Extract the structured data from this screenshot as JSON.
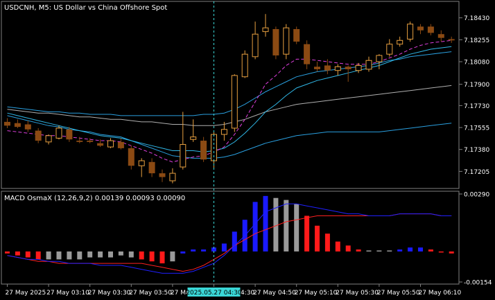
{
  "colors": {
    "background": "#000000",
    "panel_border": "#7f7f7f",
    "text": "#ffffff",
    "bull_candle": "#e8a040",
    "bear_candle": "#8b4a13",
    "ma_magenta": "#e040e0",
    "ma_cyan_fast": "#30b8e8",
    "ma_gray": "#b0b0b0",
    "band": "#2aa0e0",
    "crosshair": "#3ad7d7",
    "crosshair_label_bg": "#3ad7d7",
    "macd_up": "#1a1aff",
    "macd_down": "#ff1a1a",
    "macd_flat": "#9a9a9a",
    "macd_signal": "#ff2020",
    "macd_main": "#2020ff"
  },
  "chart_data": [
    {
      "type": "candlestick",
      "title": "USDCNH, M5:  US Dollar vs China Offshore Spot",
      "ylim": [
        7.1708,
        7.1855
      ],
      "yticks": [
        7.1843,
        7.18255,
        7.1808,
        7.179,
        7.1773,
        7.17555,
        7.1738,
        7.17205
      ],
      "ytick_labels": [
        "7.18430",
        "7.18255",
        "7.18080",
        "7.17900",
        "7.17730",
        "7.17555",
        "7.17380",
        "7.17205"
      ],
      "bars": [
        {
          "o": 7.176,
          "h": 7.1763,
          "l": 7.1755,
          "c": 7.1757
        },
        {
          "o": 7.1759,
          "h": 7.1762,
          "l": 7.1755,
          "c": 7.1756
        },
        {
          "o": 7.1758,
          "h": 7.1761,
          "l": 7.1752,
          "c": 7.1754
        },
        {
          "o": 7.1753,
          "h": 7.1755,
          "l": 7.1743,
          "c": 7.1745
        },
        {
          "o": 7.1744,
          "h": 7.175,
          "l": 7.1742,
          "c": 7.1749
        },
        {
          "o": 7.1747,
          "h": 7.1757,
          "l": 7.1746,
          "c": 7.1755
        },
        {
          "o": 7.1754,
          "h": 7.1756,
          "l": 7.1744,
          "c": 7.1746
        },
        {
          "o": 7.1745,
          "h": 7.1748,
          "l": 7.1743,
          "c": 7.1744
        },
        {
          "o": 7.1745,
          "h": 7.1747,
          "l": 7.1743,
          "c": 7.1744
        },
        {
          "o": 7.1743,
          "h": 7.1746,
          "l": 7.174,
          "c": 7.1741
        },
        {
          "o": 7.174,
          "h": 7.1747,
          "l": 7.1739,
          "c": 7.1745
        },
        {
          "o": 7.1744,
          "h": 7.1747,
          "l": 7.1738,
          "c": 7.1739
        },
        {
          "o": 7.1739,
          "h": 7.1741,
          "l": 7.1722,
          "c": 7.1725
        },
        {
          "o": 7.1725,
          "h": 7.1731,
          "l": 7.1716,
          "c": 7.1729
        },
        {
          "o": 7.1728,
          "h": 7.1731,
          "l": 7.1716,
          "c": 7.1719
        },
        {
          "o": 7.1719,
          "h": 7.1722,
          "l": 7.1712,
          "c": 7.1716
        },
        {
          "o": 7.1713,
          "h": 7.1723,
          "l": 7.1711,
          "c": 7.1719
        },
        {
          "o": 7.1724,
          "h": 7.1768,
          "l": 7.1722,
          "c": 7.1742
        },
        {
          "o": 7.1746,
          "h": 7.1762,
          "l": 7.1744,
          "c": 7.1748
        },
        {
          "o": 7.1745,
          "h": 7.1748,
          "l": 7.1728,
          "c": 7.173
        },
        {
          "o": 7.1729,
          "h": 7.1752,
          "l": 7.1723,
          "c": 7.175
        },
        {
          "o": 7.175,
          "h": 7.176,
          "l": 7.1745,
          "c": 7.1754
        },
        {
          "o": 7.1755,
          "h": 7.1798,
          "l": 7.1752,
          "c": 7.1797
        },
        {
          "o": 7.1796,
          "h": 7.1817,
          "l": 7.1795,
          "c": 7.1814
        },
        {
          "o": 7.1812,
          "h": 7.184,
          "l": 7.181,
          "c": 7.183
        },
        {
          "o": 7.1832,
          "h": 7.1846,
          "l": 7.1828,
          "c": 7.1835
        },
        {
          "o": 7.1834,
          "h": 7.1836,
          "l": 7.181,
          "c": 7.1813
        },
        {
          "o": 7.1814,
          "h": 7.1838,
          "l": 7.181,
          "c": 7.1835
        },
        {
          "o": 7.1834,
          "h": 7.1836,
          "l": 7.1822,
          "c": 7.1824
        },
        {
          "o": 7.1822,
          "h": 7.1825,
          "l": 7.1802,
          "c": 7.1806
        },
        {
          "o": 7.1804,
          "h": 7.1808,
          "l": 7.18,
          "c": 7.1802
        },
        {
          "o": 7.1805,
          "h": 7.181,
          "l": 7.1798,
          "c": 7.1801
        },
        {
          "o": 7.1801,
          "h": 7.1806,
          "l": 7.1797,
          "c": 7.1804
        },
        {
          "o": 7.1804,
          "h": 7.1805,
          "l": 7.1792,
          "c": 7.1802
        },
        {
          "o": 7.1801,
          "h": 7.1807,
          "l": 7.1799,
          "c": 7.1805
        },
        {
          "o": 7.1802,
          "h": 7.1812,
          "l": 7.18,
          "c": 7.1809
        },
        {
          "o": 7.1808,
          "h": 7.1814,
          "l": 7.1802,
          "c": 7.1813
        },
        {
          "o": 7.1814,
          "h": 7.1826,
          "l": 7.1812,
          "c": 7.1822
        },
        {
          "o": 7.1822,
          "h": 7.1828,
          "l": 7.182,
          "c": 7.1825
        },
        {
          "o": 7.1826,
          "h": 7.184,
          "l": 7.1824,
          "c": 7.1838
        },
        {
          "o": 7.1836,
          "h": 7.1838,
          "l": 7.183,
          "c": 7.1833
        },
        {
          "o": 7.1836,
          "h": 7.1838,
          "l": 7.1829,
          "c": 7.1831
        },
        {
          "o": 7.183,
          "h": 7.1833,
          "l": 7.1824,
          "c": 7.1827
        },
        {
          "o": 7.1826,
          "h": 7.1828,
          "l": 7.1823,
          "c": 7.1825
        }
      ],
      "ma_magenta": [
        7.1753,
        7.1752,
        7.1751,
        7.175,
        7.1749,
        7.1749,
        7.1748,
        7.1747,
        7.1746,
        7.1745,
        7.1745,
        7.1744,
        7.1741,
        7.1738,
        7.1735,
        7.1731,
        7.1728,
        7.173,
        7.1732,
        7.1733,
        7.1736,
        7.174,
        7.175,
        7.1762,
        7.1776,
        7.179,
        7.1797,
        7.1805,
        7.181,
        7.181,
        7.1809,
        7.1808,
        7.1807,
        7.1806,
        7.1806,
        7.1806,
        7.1808,
        7.1811,
        7.1814,
        7.1818,
        7.1821,
        7.1823,
        7.1824,
        7.1825
      ],
      "ma_cyan_fast": [
        7.1767,
        7.1765,
        7.1763,
        7.1761,
        7.1759,
        7.1757,
        7.1755,
        7.1753,
        7.1751,
        7.1749,
        7.1748,
        7.1747,
        7.1745,
        7.1743,
        7.1741,
        7.1739,
        7.1737,
        7.1737,
        7.1737,
        7.1736,
        7.1737,
        7.1739,
        7.1744,
        7.1751,
        7.1759,
        7.1768,
        7.1774,
        7.1781,
        7.1787,
        7.179,
        7.1793,
        7.1795,
        7.1797,
        7.1799,
        7.1801,
        7.1803,
        7.1805,
        7.1808,
        7.1811,
        7.1814,
        7.1816,
        7.1818,
        7.1819,
        7.182
      ],
      "ma_gray": [
        7.177,
        7.1769,
        7.1768,
        7.1767,
        7.1767,
        7.1766,
        7.1765,
        7.1764,
        7.1764,
        7.1763,
        7.1762,
        7.1762,
        7.1761,
        7.176,
        7.176,
        7.1759,
        7.1758,
        7.1758,
        7.1757,
        7.1757,
        7.1757,
        7.1758,
        7.176,
        7.1762,
        7.1765,
        7.1768,
        7.177,
        7.1772,
        7.1774,
        7.1775,
        7.1776,
        7.1777,
        7.1778,
        7.1779,
        7.178,
        7.1781,
        7.1782,
        7.1783,
        7.1784,
        7.1785,
        7.1786,
        7.1787,
        7.1788,
        7.1789
      ],
      "band_upper": [
        7.1772,
        7.1771,
        7.177,
        7.1769,
        7.1768,
        7.1768,
        7.1767,
        7.1767,
        7.1766,
        7.1766,
        7.1766,
        7.1765,
        7.1765,
        7.1765,
        7.1765,
        7.1765,
        7.1765,
        7.1765,
        7.1765,
        7.1766,
        7.1766,
        7.1767,
        7.177,
        7.1774,
        7.1779,
        7.1784,
        7.1788,
        7.1792,
        7.1796,
        7.1798,
        7.18,
        7.1801,
        7.1802,
        7.1803,
        7.1804,
        7.1805,
        7.1807,
        7.1809,
        7.181,
        7.1812,
        7.1813,
        7.1814,
        7.1815,
        7.1816
      ],
      "band_lower": [
        7.1765,
        7.1763,
        7.1761,
        7.1759,
        7.1757,
        7.1756,
        7.1754,
        7.1753,
        7.1752,
        7.175,
        7.1749,
        7.1748,
        7.1745,
        7.1742,
        7.1739,
        7.1736,
        7.1733,
        7.1732,
        7.1731,
        7.1731,
        7.1731,
        7.1732,
        7.1734,
        7.1737,
        7.174,
        7.1743,
        7.1745,
        7.1747,
        7.1749,
        7.175,
        7.1751,
        7.1752,
        7.1752,
        7.1752,
        7.1752,
        7.1752,
        7.1752,
        7.1753,
        7.1754,
        7.1755,
        7.1756,
        7.1757,
        7.1758,
        7.1759
      ]
    },
    {
      "type": "bar",
      "title": "MACD OsmaX (12,26,9,2) 0.00139 0.00093 0.00090",
      "ylim": [
        -0.00154,
        0.0029
      ],
      "ytick_labels": [
        "0.00290",
        "-0.00154"
      ],
      "histogram": [
        -0.0001,
        -0.0002,
        -0.0003,
        -0.0004,
        -0.0004,
        -0.0004,
        -0.0004,
        -0.0004,
        -0.0003,
        -0.0003,
        -0.0003,
        -0.0002,
        -0.0003,
        -0.0004,
        -0.0005,
        -0.0006,
        -0.0005,
        -0.0001,
        0.0001,
        0.0001,
        0.0002,
        0.0004,
        0.001,
        0.0016,
        0.0025,
        0.0028,
        0.0027,
        0.0026,
        0.0024,
        0.0018,
        0.0013,
        0.0009,
        0.0005,
        0.0003,
        0.0001,
        5e-05,
        5e-05,
        5e-05,
        0.0001,
        0.0002,
        0.0002,
        0.0001,
        0.0,
        -0.0001
      ],
      "histogram_state": [
        "down",
        "down",
        "down",
        "down",
        "flat",
        "flat",
        "flat",
        "flat",
        "flat",
        "flat",
        "flat",
        "flat",
        "flat",
        "down",
        "down",
        "down",
        "flat",
        "up",
        "up",
        "up",
        "up",
        "up",
        "up",
        "up",
        "up",
        "up",
        "flat",
        "flat",
        "flat",
        "down",
        "down",
        "down",
        "down",
        "down",
        "down",
        "flat",
        "flat",
        "flat",
        "up",
        "up",
        "up",
        "down",
        "down",
        "down"
      ],
      "signal": [
        -0.0002,
        -0.0003,
        -0.0004,
        -0.0005,
        -0.0005,
        -0.0006,
        -0.0006,
        -0.0006,
        -0.0006,
        -0.0006,
        -0.0006,
        -0.0006,
        -0.0006,
        -0.0006,
        -0.0007,
        -0.0008,
        -0.0009,
        -0.001,
        -0.0009,
        -0.0007,
        -0.0004,
        -0.0001,
        0.0003,
        0.0006,
        0.0009,
        0.0011,
        0.0013,
        0.0015,
        0.0016,
        0.0017,
        0.0018,
        0.0018,
        0.0018,
        0.0018,
        0.0018,
        0.0018,
        0.0018,
        0.0018,
        0.0019,
        0.0019,
        0.0019,
        0.0019,
        0.0018,
        0.0018
      ],
      "main": [
        -0.0002,
        -0.0003,
        -0.0004,
        -0.0004,
        -0.0005,
        -0.0005,
        -0.0006,
        -0.0006,
        -0.0006,
        -0.0007,
        -0.0007,
        -0.0007,
        -0.0008,
        -0.0009,
        -0.001,
        -0.0011,
        -0.0011,
        -0.0011,
        -0.001,
        -0.0008,
        -0.0006,
        -0.0002,
        0.0003,
        0.0008,
        0.0014,
        0.002,
        0.0022,
        0.0024,
        0.0024,
        0.0023,
        0.0022,
        0.0021,
        0.002,
        0.0019,
        0.0019,
        0.0018,
        0.0018,
        0.0018,
        0.0019,
        0.0019,
        0.0019,
        0.0019,
        0.0018,
        0.0018
      ]
    }
  ],
  "time_axis": {
    "labels": [
      "27 May 2025",
      "27 May 03:10",
      "27 May 03:30",
      "27 May 03:50",
      "27 May 04:10",
      "27 May 04:30",
      "27 May 04:50",
      "27 May 05:10",
      "27 May 05:30",
      "27 May 05:50",
      "27 May 06:10"
    ],
    "label_bars": [
      0,
      4,
      8,
      12,
      16,
      20,
      24,
      28,
      32,
      36,
      40
    ],
    "crosshair_label": "2025.05.27 04:30",
    "crosshair_bar": 20
  }
}
